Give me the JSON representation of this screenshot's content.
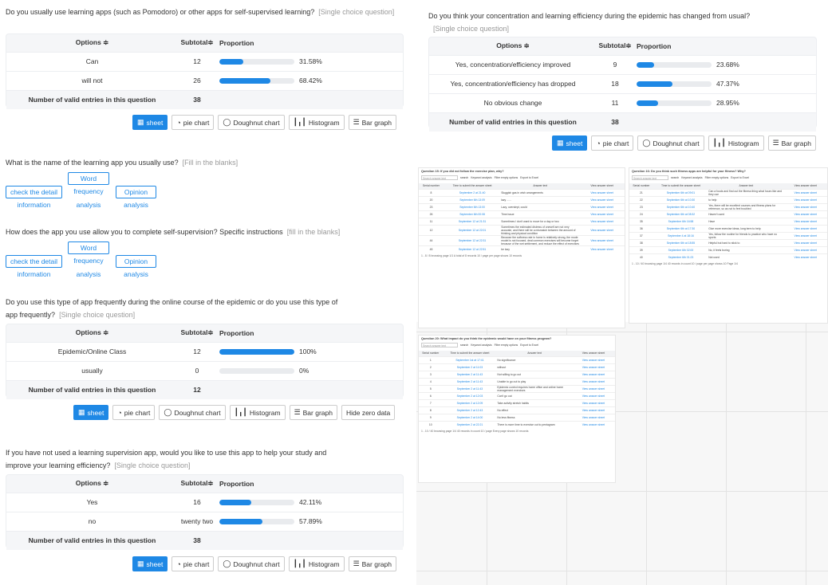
{
  "buttons": {
    "sheet": "sheet",
    "pie": "pie chart",
    "doughnut": "Doughnut chart",
    "histogram": "Histogram",
    "bar": "Bar graph",
    "hide_zero": "Hide zero data"
  },
  "table_headers": {
    "options": "Options ≑",
    "subtotal": "Subtotal≑",
    "proportion": "Proportion"
  },
  "total_label": "Number of valid entries in this question",
  "q1": {
    "title": "Do you usually use learning apps (such as Pomodoro) or other apps for self-supervised learning?",
    "type": "[Single choice question]",
    "rows": [
      {
        "option": "Can",
        "count": "12",
        "pct_label": "31.58%",
        "pct": 31.58
      },
      {
        "option": "will not",
        "count": "26",
        "pct_label": "68.42%",
        "pct": 68.42
      }
    ],
    "total": "38"
  },
  "q2": {
    "title": "What is the name of the learning app you usually use?",
    "type": "[Fill in the blanks]",
    "links": {
      "check": "check the detail",
      "check_sub": "information",
      "word_top": "Word",
      "word": "frequency",
      "word_sub": "analysis",
      "opinion": "Opinion",
      "opinion_sub": "analysis"
    }
  },
  "q3": {
    "title": "How does the app you use allow you to complete self-supervision? Specific instructions",
    "type": "[fill in the blanks]",
    "links": {
      "check": "check the detail",
      "check_sub": "information",
      "word_top": "Word",
      "word": "frequency",
      "word_sub": "analysis",
      "opinion": "Opinion",
      "opinion_sub": "analysis"
    }
  },
  "q4": {
    "title1": "Do you use this type of app frequently during the online course of the epidemic or do you use this type of",
    "title2": "app frequently?",
    "type": "[Single choice question]",
    "rows": [
      {
        "option": "Epidemic/Online Class",
        "count": "12",
        "pct_label": "100%",
        "pct": 100
      },
      {
        "option": "usually",
        "count": "0",
        "pct_label": "0%",
        "pct": 0
      }
    ],
    "total": "12"
  },
  "q5": {
    "title1": "If you have not used a learning supervision app, would you like to use this app to help your study and",
    "title2": "improve your learning efficiency?",
    "type": "[Single choice question]",
    "rows": [
      {
        "option": "Yes",
        "count": "16",
        "pct_label": "42.11%",
        "pct": 42.11
      },
      {
        "option": "no",
        "count": "twenty two",
        "pct_label": "57.89%",
        "pct": 57.89
      }
    ],
    "total": "38"
  },
  "q6": {
    "title": "Do you think your concentration and learning efficiency during the epidemic has changed from usual?",
    "type": "[Single choice question]",
    "rows": [
      {
        "option": "Yes, concentration/efficiency improved",
        "count": "9",
        "pct_label": "23.68%",
        "pct": 23.68
      },
      {
        "option": "Yes, concentration/efficiency has dropped",
        "count": "18",
        "pct_label": "47.37%",
        "pct": 47.37
      },
      {
        "option": "No obvious change",
        "count": "11",
        "pct_label": "28.95%",
        "pct": 28.95
      }
    ],
    "total": "38"
  },
  "mini1": {
    "title": "Question 15: If you did not follow the exercise plan, why?",
    "search": "Search answer text",
    "search_btn": "search",
    "keyword": "Keyword analysis",
    "filter": "Filter empty options",
    "export": "Export to Excel",
    "headers": [
      "Serial number",
      "Time to submit the answer sheet",
      "Answer text",
      "View answer sheet"
    ],
    "rows": [
      [
        "8",
        "September 2 at 21:40",
        "Sluggish gas in wish arrangements",
        "View answer sheet"
      ],
      [
        "20",
        "September 6th 13:09",
        "lazy ......",
        "View answer sheet"
      ],
      [
        "23",
        "September 6th 13:00",
        "Lazy, overslept, could",
        "View answer sheet"
      ],
      [
        "26",
        "September 6th 00:08",
        "Time issue",
        "View answer sheet"
      ],
      [
        "11",
        "September 12 at 21:31",
        "Sometimes I don't want to move for a day or two",
        "View answer sheet"
      ],
      [
        "12",
        "September 12 at 22:01",
        "Sometimes the estimated distress of oneself are not very accurate, and there will be a mismatch between the amount of thinking and physical condition",
        "View answer sheet"
      ],
      [
        "44",
        "September 12 at 22:31",
        "Because the softness rate in home is relatively strong, the mode model is not focused, deal common exercises will become forget because of the wet settlement, and reduce the effect of exercises",
        "View answer sheet"
      ],
      [
        "45",
        "September 12 at 22:51",
        "be lazy",
        "View answer sheet"
      ]
    ],
    "footer": "1 - 8 / 8 browsing page 1/1  A total of 8 records  10 / page  per page shows 10 records"
  },
  "mini2": {
    "title": "Question 16: Do you think such fitness apps are helpful for your fitness? Why?",
    "search": "Search answer text",
    "search_btn": "search",
    "keyword": "Keyword analysis",
    "filter": "Filter empty options",
    "export": "Export to Excel",
    "headers": [
      "Serial number",
      "Time to submit the answer sheet",
      "Answer text",
      "View answer sheet"
    ],
    "rows": [
      [
        "21",
        "September 6th at 09:01",
        "Can a foods and find out the fitness thing what hours like and they use",
        "View answer sheet"
      ],
      [
        "22",
        "September 6th at 10:30",
        "to help",
        "View answer sheet"
      ],
      [
        "23",
        "September 6th at 10:40",
        "Yes, there will be excellent courses and fitness plans for reference, so as not to feel troubled",
        "View answer sheet"
      ],
      [
        "24",
        "September 6th at 08:32",
        "Haven't used",
        "View answer sheet"
      ],
      [
        "35",
        "September 6th 16:58",
        "Have",
        "View answer sheet"
      ],
      [
        "36",
        "September 6th at 17:30",
        "Give more exercise ideas, long term to help",
        "View answer sheet"
      ],
      [
        "37",
        "September 4 at 18:16",
        "Yes, follow the routine for friends to practice who have no sports",
        "View answer sheet"
      ],
      [
        "38",
        "September 6th at 18:55",
        "Helpful but hard to stick to",
        "View answer sheet"
      ],
      [
        "39",
        "September 6th 02:00",
        "No, it feels boring",
        "View answer sheet"
      ],
      [
        "40",
        "September 6th 01:23",
        "Not used",
        "View answer sheet"
      ]
    ],
    "footer": "1 - 10 / 40 browsing page 1/4  40 records in count  10 / page  per page shows 10  Page 1/4"
  },
  "mini3": {
    "title": "Question 20: What impact do you think the epidemic would have on your fitness program?",
    "search": "Search answer text",
    "search_btn": "search",
    "keyword": "Keyword analysis",
    "filter": "Filter empty options",
    "export": "Export to Excel",
    "headers": [
      "Serial number",
      "Time to submit the answer sheet",
      "Answer text",
      "View answer sheet"
    ],
    "rows": [
      [
        "1",
        "September 1st at 17:41",
        "No significance",
        "View answer sheet"
      ],
      [
        "2",
        "September 2 at 11:03",
        "without",
        "View answer sheet"
      ],
      [
        "3",
        "September 2 at 11:43",
        "Not willing to go out",
        "View answer sheet"
      ],
      [
        "4",
        "September 2 at 11:43",
        "Unable to go out to play",
        "View answer sheet"
      ],
      [
        "5",
        "September 2 at 11:43",
        "Epidemic control requires home office and online home management exercises",
        "View answer sheet"
      ],
      [
        "6",
        "September 2 at 12:03",
        "Can't go out",
        "View answer sheet"
      ],
      [
        "7",
        "September 2 at 12:09",
        "Take activity stretch habits",
        "View answer sheet"
      ],
      [
        "8",
        "September 2 at 12:43",
        "No effect",
        "View answer sheet"
      ],
      [
        "9",
        "September 2 at 14:00",
        "No less fitness",
        "View answer sheet"
      ],
      [
        "10",
        "September 2 at 22:21",
        "There is more time to exercise out to pentagram",
        "View answer sheet"
      ]
    ],
    "footer": "1 - 10 / 40 browsing page 1/4  40 records in count  10 / page  Every page shows 10 records"
  }
}
